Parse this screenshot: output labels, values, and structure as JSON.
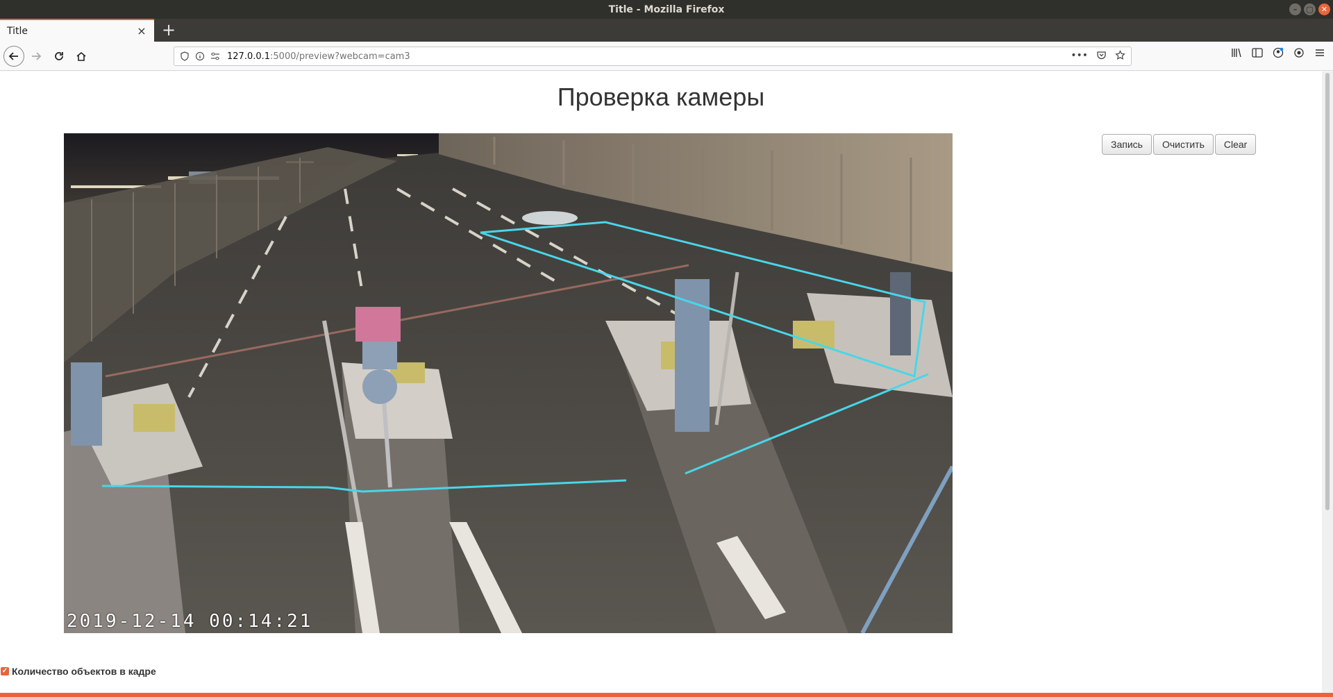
{
  "window": {
    "title": "Title - Mozilla Firefox",
    "controls": [
      "–",
      "▢",
      "✕"
    ]
  },
  "tabs": [
    {
      "label": "Title",
      "close": "×",
      "active": true
    }
  ],
  "new_tab": "+",
  "urlbar": {
    "host": "127.0.0.1",
    "rest": ":5000/preview?webcam=cam3",
    "more": "•••"
  },
  "page": {
    "title": "Проверка камеры",
    "buttons": {
      "record": "Запись",
      "clear_ru": "Очистить",
      "clear_en": "Clear"
    },
    "camera": {
      "timestamp": "2019-12-14  00:14:21"
    },
    "counter": {
      "label": "Количество объектов в кадре",
      "checked": true
    }
  },
  "colors": {
    "accent": "#e9643b",
    "overlay_line": "#49d6e8"
  },
  "icons": {
    "back": "arrow-left",
    "forward": "arrow-right",
    "reload": "reload",
    "home": "home",
    "shield": "shield",
    "info": "info",
    "permissions": "sliders",
    "pocket": "pocket",
    "bookmark": "star",
    "library": "library",
    "sidebar": "sidebar",
    "account": "account",
    "extension": "extension",
    "menu": "hamburger"
  }
}
